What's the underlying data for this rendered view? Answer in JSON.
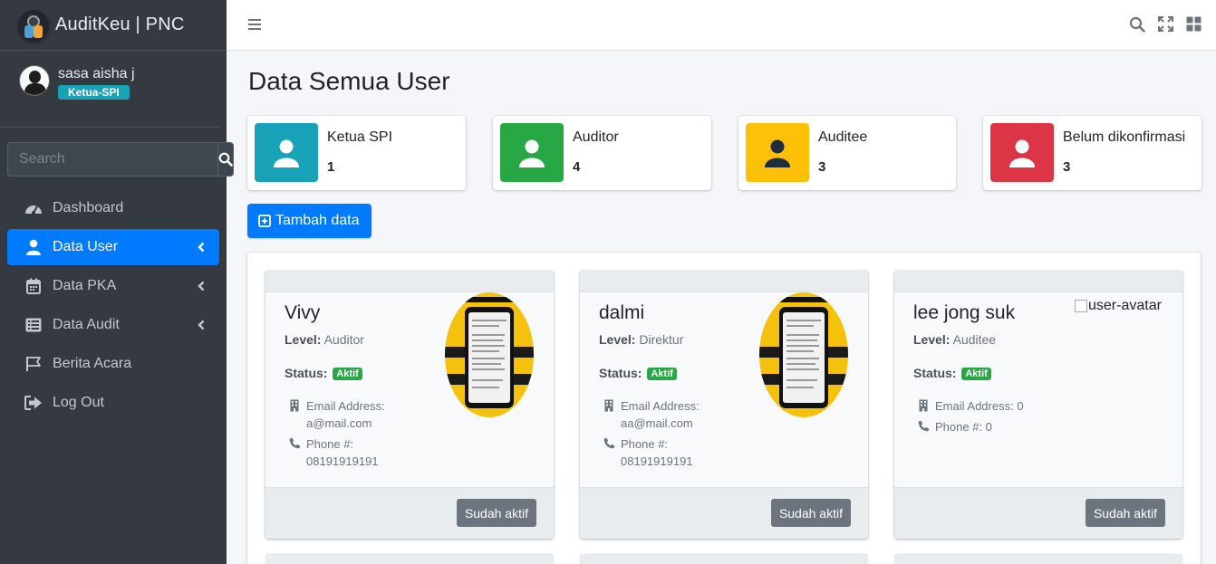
{
  "brand": {
    "title": "AuditKeu | PNC"
  },
  "user": {
    "name": "sasa aisha j",
    "role": "Ketua-SPI"
  },
  "search": {
    "placeholder": "Search"
  },
  "sidebar": {
    "items": [
      {
        "label": "Dashboard",
        "icon": "tachometer-icon"
      },
      {
        "label": "Data User",
        "icon": "user-icon",
        "active": true
      },
      {
        "label": "Data PKA",
        "icon": "calendar-icon"
      },
      {
        "label": "Data Audit",
        "icon": "list-icon"
      },
      {
        "label": "Berita Acara",
        "icon": "flag-icon"
      },
      {
        "label": "Log Out",
        "icon": "sign-out-icon"
      }
    ]
  },
  "page": {
    "title": "Data Semua User"
  },
  "stats": [
    {
      "label": "Ketua SPI",
      "count": "1",
      "color": "#17a2b8"
    },
    {
      "label": "Auditor",
      "count": "4",
      "color": "#28a745"
    },
    {
      "label": "Auditee",
      "count": "3",
      "color": "#ffc107"
    },
    {
      "label": "Belum dikonfirmasi",
      "count": "3",
      "color": "#dc3545"
    }
  ],
  "actions": {
    "add_label": "Tambah data"
  },
  "labels": {
    "level": "Level:",
    "status": "Status:",
    "email": "Email Address:",
    "phone": "Phone #:"
  },
  "cards": [
    {
      "name": "Vivy",
      "level": "Auditor",
      "status": "Aktif",
      "email": "a@mail.com",
      "phone": "08191919191",
      "button": "Sudah aktif"
    },
    {
      "name": "dalmi",
      "level": "Direktur",
      "status": "Aktif",
      "email": "aa@mail.com",
      "phone": "08191919191",
      "button": "Sudah aktif"
    },
    {
      "name": "lee jong suk",
      "level": "Auditee",
      "status": "Aktif",
      "email": "0",
      "phone": "0",
      "button": "Sudah aktif",
      "avatar_alt": "user-avatar"
    }
  ]
}
